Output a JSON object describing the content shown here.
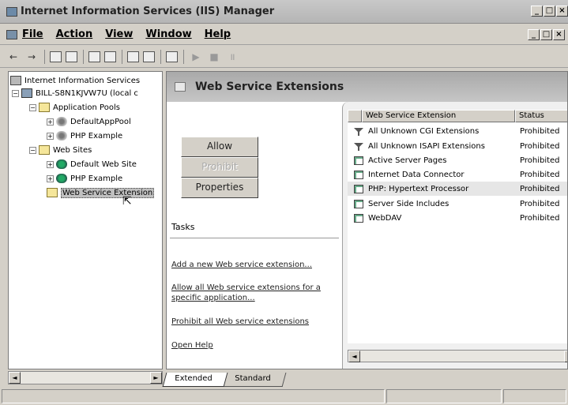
{
  "window": {
    "title": "Internet Information Services (IIS) Manager",
    "controls": [
      "_",
      "□",
      "×"
    ]
  },
  "menu": {
    "items": [
      "File",
      "Action",
      "View",
      "Window",
      "Help"
    ],
    "mdi_controls": [
      "_",
      "□",
      "×"
    ]
  },
  "toolbar": {
    "back_glyph": "←",
    "forward_glyph": "→",
    "play_glyph": "▶",
    "stop_glyph": "■",
    "pause_glyph": "॥"
  },
  "tree": {
    "root": "Internet Information Services",
    "server": "BILL-S8N1KJVW7U (local c",
    "app_pools": "Application Pools",
    "default_pool": "DefaultAppPool",
    "php_pool": "PHP Example",
    "web_sites": "Web Sites",
    "default_site": "Default Web Site",
    "php_site": "PHP Example",
    "web_service_ext": "Web Service Extension"
  },
  "panel": {
    "title": "Web Service Extensions",
    "allow_label": "Allow",
    "prohibit_label": "Prohibit",
    "properties_label": "Properties",
    "tasks_heading": "Tasks",
    "tasks": [
      "Add a new Web service extension...",
      "Allow all Web service extensions for a specific application...",
      "Prohibit all Web service extensions",
      "Open Help"
    ]
  },
  "list": {
    "columns": [
      "Web Service Extension",
      "Status"
    ],
    "rows": [
      {
        "name": "All Unknown CGI Extensions",
        "status": "Prohibited",
        "icon": "filter-icon"
      },
      {
        "name": "All Unknown ISAPI Extensions",
        "status": "Prohibited",
        "icon": "filter-icon"
      },
      {
        "name": "Active Server Pages",
        "status": "Prohibited",
        "icon": "extension-icon"
      },
      {
        "name": "Internet Data Connector",
        "status": "Prohibited",
        "icon": "extension-icon"
      },
      {
        "name": "PHP: Hypertext Processor",
        "status": "Prohibited",
        "icon": "extension-icon"
      },
      {
        "name": "Server Side Includes",
        "status": "Prohibited",
        "icon": "extension-icon"
      },
      {
        "name": "WebDAV",
        "status": "Prohibited",
        "icon": "extension-icon"
      }
    ]
  },
  "tabs": [
    "Extended",
    "Standard"
  ],
  "scroll": {
    "left": "◄",
    "right": "►"
  },
  "colors": {
    "face": "#d4d0c8",
    "header_gradient_top": "#a9a9a9",
    "selection": "#c0c0c0"
  }
}
